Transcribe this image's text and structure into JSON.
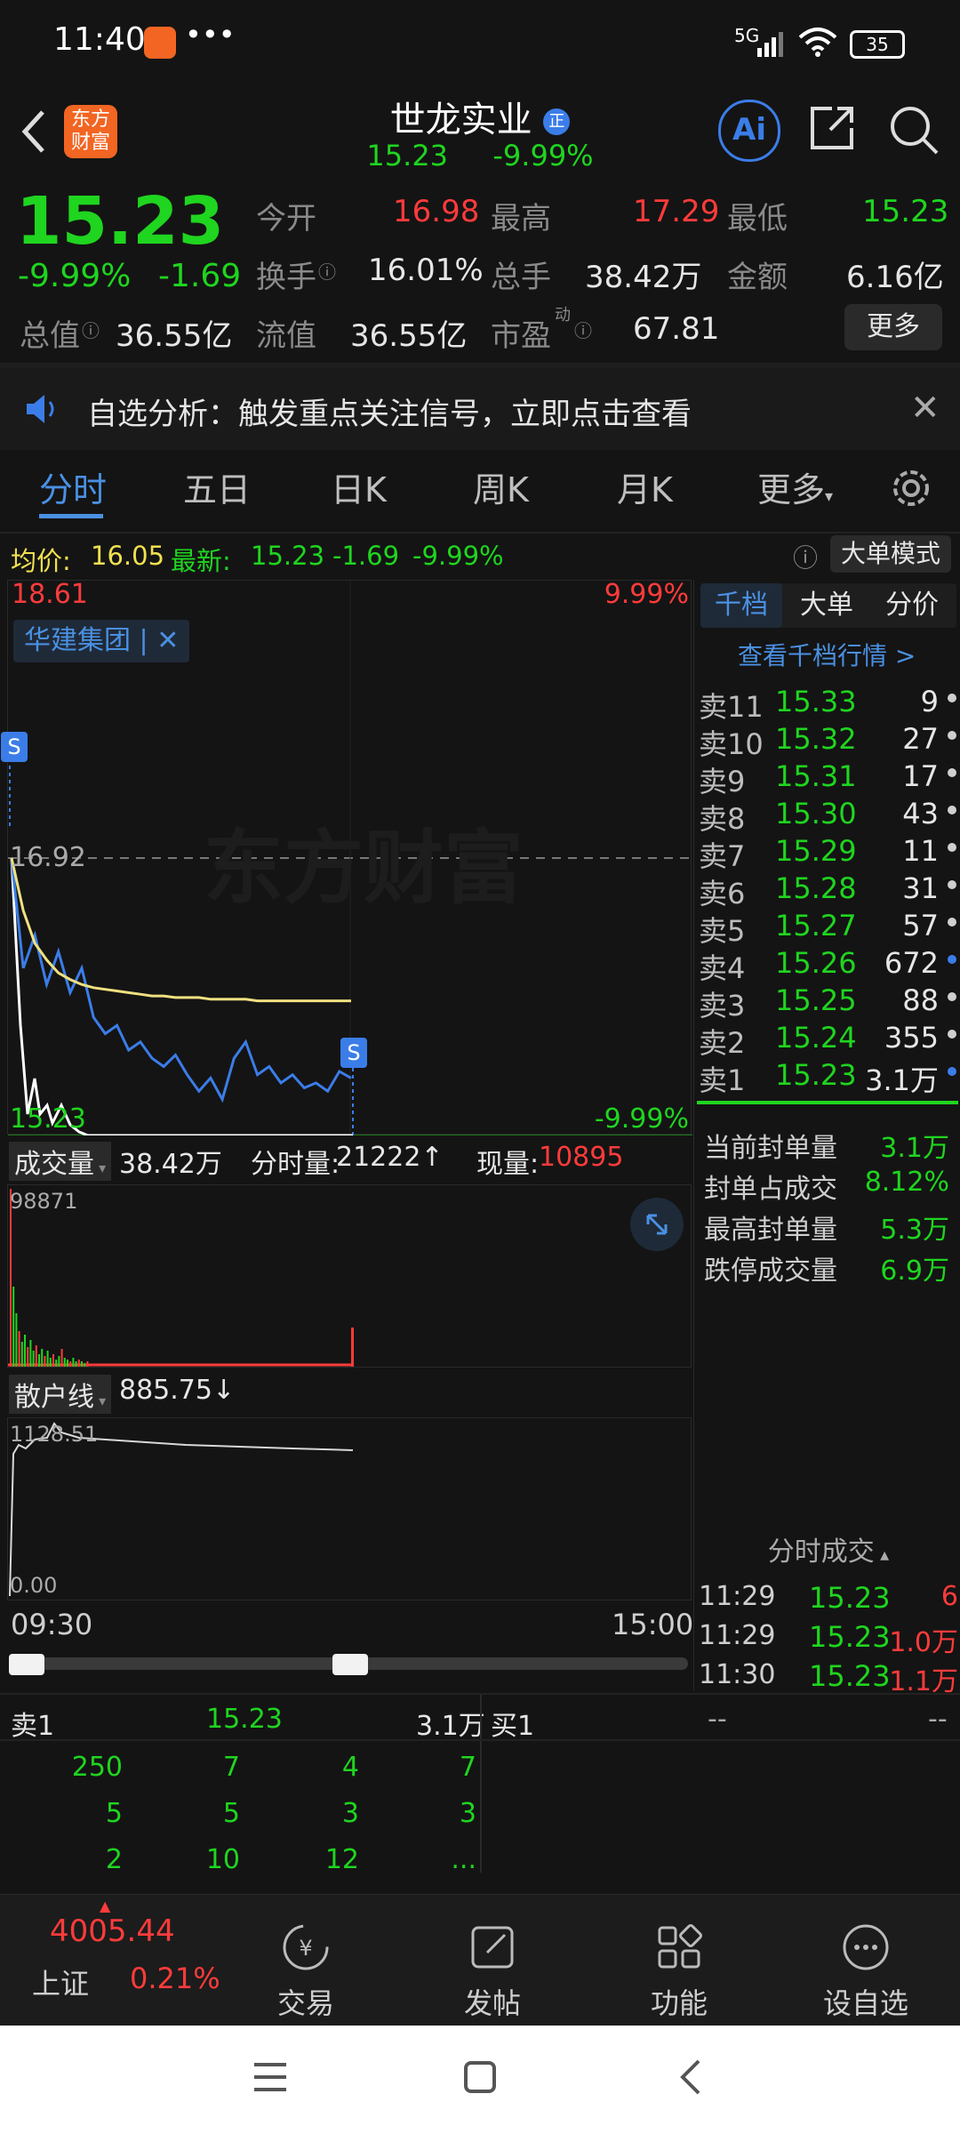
{
  "status_bar": {
    "time": "11:40",
    "dots": "•••",
    "network": "5G",
    "battery": "35"
  },
  "header": {
    "logo_text": "东方财富",
    "stock_name": "世龙实业",
    "stock_badge": "正",
    "price": "15.23",
    "change_pct": "-9.99%"
  },
  "quote": {
    "price": "15.23",
    "change_pct": "-9.99%",
    "change": "-1.69",
    "open_label": "今开",
    "open": "16.98",
    "high_label": "最高",
    "high": "17.29",
    "low_label": "最低",
    "low": "15.23",
    "turnover_label": "换手",
    "turnover": "16.01%",
    "volume_label": "总手",
    "volume": "38.42万",
    "amount_label": "金额",
    "amount": "6.16亿",
    "mktcap_label": "总值",
    "mktcap": "36.55亿",
    "float_label": "流值",
    "float": "36.55亿",
    "pe_label": "市盈",
    "pe_sup": "动",
    "pe": "67.81",
    "more_button": "更多"
  },
  "notice": {
    "text": "自选分析：触发重点关注信号，立即点击查看"
  },
  "tabs": [
    "分时",
    "五日",
    "日K",
    "周K",
    "月K",
    "更多"
  ],
  "info_line": {
    "avg_label": "均价:",
    "avg": "16.05",
    "latest_label": "最新:",
    "latest": "15.23",
    "chg": "-1.69",
    "pct": "-9.99%",
    "big_order_button": "大单模式"
  },
  "chart_labels": {
    "top_left": "18.61",
    "top_right": "9.99%",
    "mid_left": "16.92",
    "bottom_left": "15.23",
    "bottom_right": "-9.99%",
    "group_tag": "华建集团",
    "s_marker": "S",
    "watermark": "东方财富"
  },
  "chart_data": {
    "type": "line",
    "title": "",
    "xlabel": "",
    "ylabel": "",
    "x_range": [
      "09:30",
      "15:00"
    ],
    "ylim": [
      15.23,
      18.61
    ],
    "prev_close": 16.92,
    "series": [
      {
        "values": [
          16.92,
          16.25,
          16.45,
          16.15,
          16.35,
          16.1,
          16.25,
          15.95,
          15.85,
          15.9,
          15.75,
          15.8,
          15.7,
          15.65,
          15.72,
          15.6,
          15.5,
          15.58,
          15.45,
          15.7,
          15.8,
          15.6,
          15.65,
          15.55,
          15.6,
          15.52,
          15.55,
          15.5,
          15.62,
          15.58
        ]
      },
      {
        "values": [
          16.92,
          16.6,
          16.4,
          16.3,
          16.22,
          16.18,
          16.15,
          16.13,
          16.12,
          16.11,
          16.1,
          16.09,
          16.08,
          16.08,
          16.07,
          16.07,
          16.07,
          16.06,
          16.06,
          16.06,
          16.06,
          16.05,
          16.05,
          16.05,
          16.05,
          16.05,
          16.05,
          16.05,
          16.05,
          16.05
        ]
      }
    ]
  },
  "volume_panel": {
    "label": "成交量",
    "total": "38.42万",
    "min_vol_label": "分时量:",
    "min_vol": "21222↑",
    "cur_vol_label": "现量:",
    "cur_vol": "10895",
    "max_label": "98871"
  },
  "retail_panel": {
    "label": "散户线",
    "value": "885.75↓",
    "max_label": "1128.51",
    "min_label": "0.00"
  },
  "time_axis": {
    "start": "09:30",
    "end": "15:00"
  },
  "order_book": {
    "tabs": [
      "千档",
      "大单",
      "分价"
    ],
    "link": "查看千档行情 >",
    "rows": [
      {
        "label": "卖11",
        "price": "15.33",
        "vol": "9"
      },
      {
        "label": "卖10",
        "price": "15.32",
        "vol": "27"
      },
      {
        "label": "卖9",
        "price": "15.31",
        "vol": "17"
      },
      {
        "label": "卖8",
        "price": "15.30",
        "vol": "43"
      },
      {
        "label": "卖7",
        "price": "15.29",
        "vol": "11"
      },
      {
        "label": "卖6",
        "price": "15.28",
        "vol": "31"
      },
      {
        "label": "卖5",
        "price": "15.27",
        "vol": "57"
      },
      {
        "label": "卖4",
        "price": "15.26",
        "vol": "672"
      },
      {
        "label": "卖3",
        "price": "15.25",
        "vol": "88"
      },
      {
        "label": "卖2",
        "price": "15.24",
        "vol": "355"
      },
      {
        "label": "卖1",
        "price": "15.23",
        "vol": "3.1万"
      }
    ],
    "seal": [
      {
        "label": "当前封单量",
        "value": "3.1万"
      },
      {
        "label": "封单占成交",
        "value": "8.12%"
      },
      {
        "label": "最高封单量",
        "value": "5.3万"
      },
      {
        "label": "跌停成交量",
        "value": "6.9万"
      }
    ],
    "ticks_title": "分时成交",
    "ticks": [
      {
        "time": "11:29",
        "price": "15.23",
        "vol": "6"
      },
      {
        "time": "11:29",
        "price": "15.23",
        "vol": "1.0万"
      },
      {
        "time": "11:30",
        "price": "15.23",
        "vol": "1.1万"
      }
    ]
  },
  "level_panel": {
    "sell_label": "卖1",
    "sell_price": "15.23",
    "sell_vol": "3.1万",
    "buy_label": "买1",
    "buy_price": "--",
    "buy_vol": "--",
    "queue": [
      [
        "250",
        "7",
        "4",
        "7"
      ],
      [
        "5",
        "5",
        "3",
        "3"
      ],
      [
        "2",
        "10",
        "12",
        "..."
      ]
    ]
  },
  "bottom_nav": {
    "index_value": "4005.44",
    "index_name": "上证",
    "index_pct": "0.21%",
    "items": [
      "交易",
      "发帖",
      "功能",
      "设自选"
    ]
  }
}
